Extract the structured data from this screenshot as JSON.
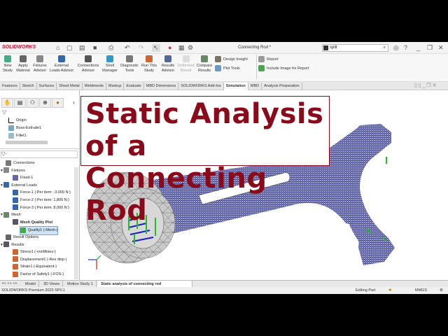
{
  "app": {
    "logo": "SOLIDWORKS",
    "title": "Connecting Rod *",
    "search_value": "split"
  },
  "ribbon": {
    "buttons": [
      {
        "label": "New Study",
        "color": "#4a8"
      },
      {
        "label": "Apply Material",
        "color": "#666"
      },
      {
        "label": "Fixtures Advisor",
        "color": "#888"
      },
      {
        "label": "External Loads Advisor",
        "color": "#36a"
      },
      {
        "label": "Connections Advisor",
        "color": "#555"
      },
      {
        "label": "Shell Manager",
        "color": "#39c"
      },
      {
        "label": "Diagnostic Tools",
        "color": "#777"
      },
      {
        "label": "Run This Study",
        "color": "#c63"
      },
      {
        "label": "Results Advisor",
        "color": "#569"
      },
      {
        "label": "Deformed Result",
        "color": "#ccc",
        "disabled": true
      },
      {
        "label": "Compare Results",
        "color": "#686"
      }
    ],
    "small": [
      "Design Insight",
      "Plot Tools",
      "Report",
      "Include Image for Report"
    ]
  },
  "tabs": [
    "Features",
    "Sketch",
    "Surfaces",
    "Sheet Metal",
    "Weldments",
    "Markup",
    "Evaluate",
    "MBD Dimensions",
    "SOLIDWORKS Add-Ins",
    "Simulation",
    "MBD",
    "Analysis Preparation"
  ],
  "active_tab": "Simulation",
  "feature_tree": [
    "Origin",
    "Boss-Extrude1",
    "Fillet1"
  ],
  "sim_tree": [
    {
      "label": "Connections",
      "level": 0
    },
    {
      "label": "Fixtures",
      "level": 0
    },
    {
      "label": "Fixed-1",
      "level": 1
    },
    {
      "label": "External Loads",
      "level": 0
    },
    {
      "label": "Force-1 (:Per item: -3,000 N:)",
      "level": 1
    },
    {
      "label": "Force-2 (:Per item: 1,800 N:)",
      "level": 1
    },
    {
      "label": "Force-3 (:Per item: 8,000 N:)",
      "level": 1
    },
    {
      "label": "Mesh",
      "level": 0
    },
    {
      "label": "Mesh Quality Plot",
      "level": 1
    },
    {
      "label": "Quality1 (-Mesh-)",
      "level": 2
    },
    {
      "label": "Result Options",
      "level": 0
    },
    {
      "label": "Results",
      "level": 0
    },
    {
      "label": "Stress1 (-vonMises-)",
      "level": 1
    },
    {
      "label": "Displacement1 (-Res disp-)",
      "level": 1
    },
    {
      "label": "Strain1 (-Equivalent-)",
      "level": 1
    },
    {
      "label": "Factor of Safety1 (-FOS-)",
      "level": 1
    }
  ],
  "banner": {
    "line1": "Static Analysis of a",
    "line2": "Connecting Rod"
  },
  "bottom_tabs": [
    "Model",
    "3D Views",
    "Motion Study 1",
    "Static analysis of connecting rod"
  ],
  "status": {
    "product": "SOLIDWORKS Premium 2023 SP0.1",
    "mode": "Editing Part",
    "units": "MMGS"
  }
}
